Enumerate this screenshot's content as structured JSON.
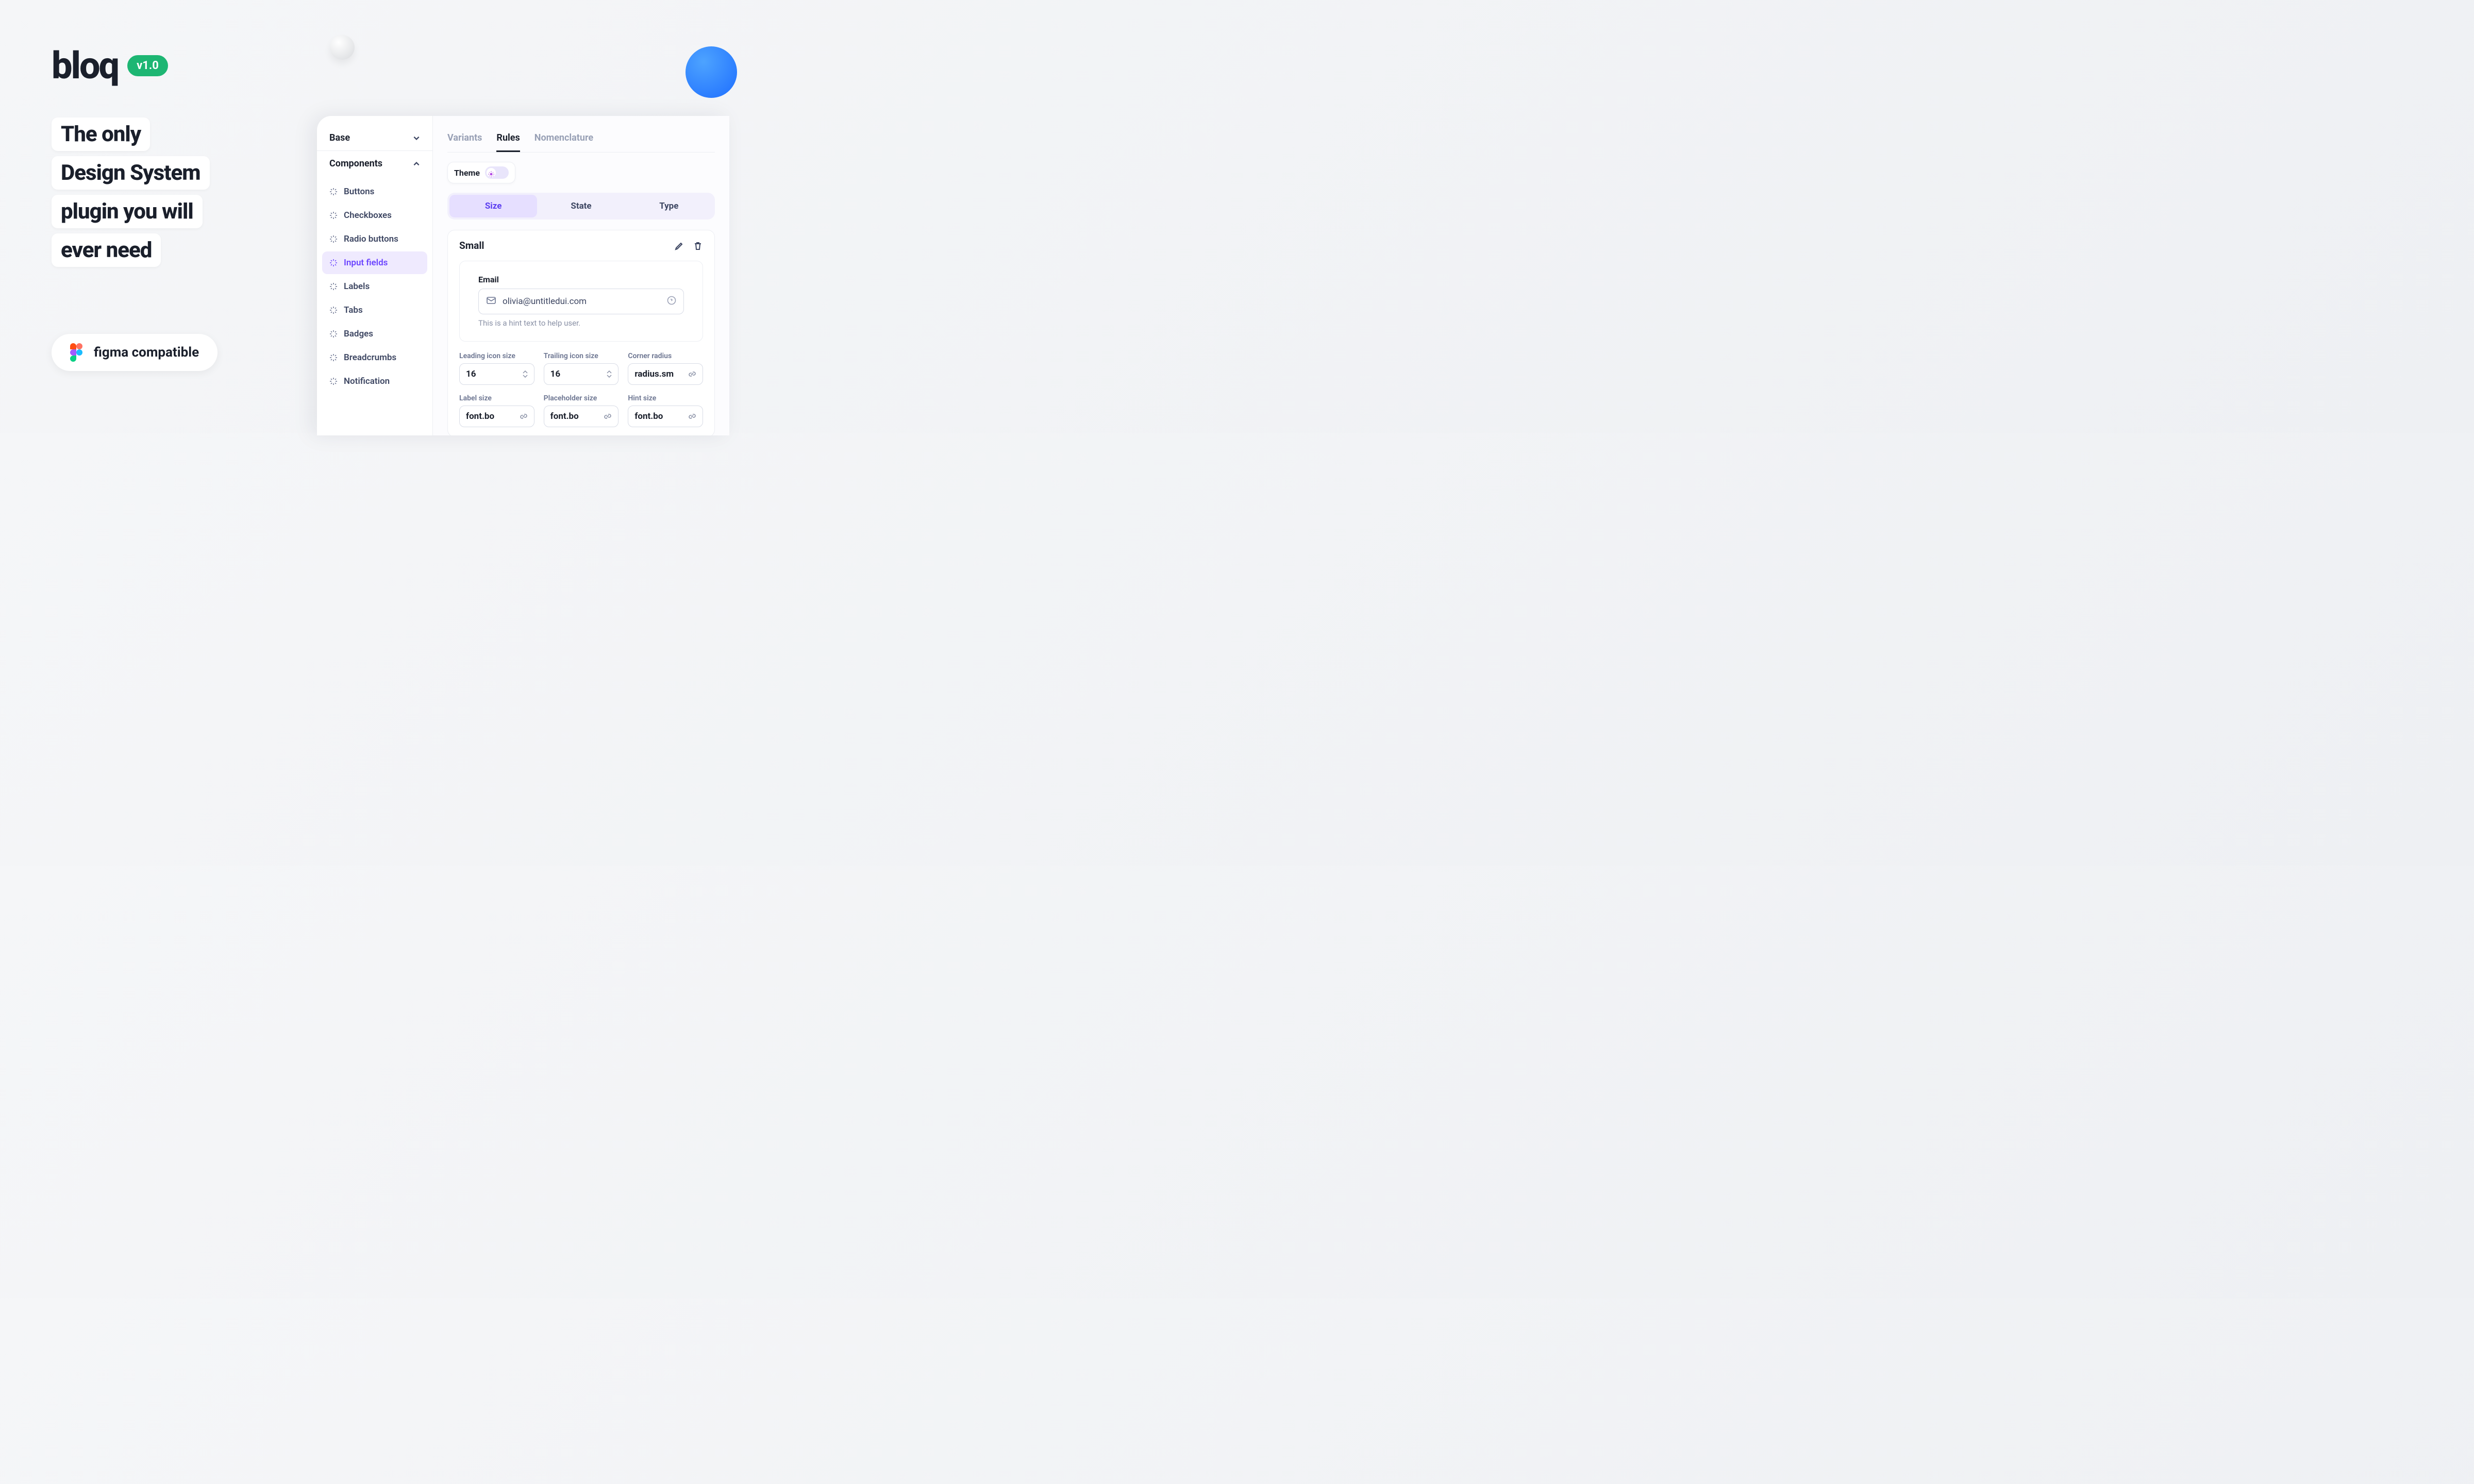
{
  "hero": {
    "logo": "bloq",
    "version": "v1.0",
    "tagline": [
      "The only",
      "Design System",
      "plugin you will",
      "ever need"
    ],
    "figma_label": "figma compatible"
  },
  "sidebar": {
    "base_label": "Base",
    "components_label": "Components",
    "items": [
      {
        "label": "Buttons"
      },
      {
        "label": "Checkboxes"
      },
      {
        "label": "Radio buttons"
      },
      {
        "label": "Input fields"
      },
      {
        "label": "Labels"
      },
      {
        "label": "Tabs"
      },
      {
        "label": "Badges"
      },
      {
        "label": "Breadcrumbs"
      },
      {
        "label": "Notification"
      }
    ],
    "active_index": 3
  },
  "tabs": {
    "items": [
      "Variants",
      "Rules",
      "Nomenclature"
    ],
    "active": "Rules"
  },
  "theme": {
    "label": "Theme",
    "mode": "light"
  },
  "segmented": {
    "items": [
      "Size",
      "State",
      "Type"
    ],
    "active": "Size"
  },
  "card": {
    "title": "Small",
    "preview": {
      "label": "Email",
      "value": "olivia@untitledui.com",
      "hint": "This is a hint text to help user."
    },
    "controls": {
      "row1": [
        {
          "label": "Leading icon size",
          "value": "16",
          "type": "stepper"
        },
        {
          "label": "Trailing icon size",
          "value": "16",
          "type": "stepper"
        },
        {
          "label": "Corner radius",
          "value": "radius.sm",
          "type": "link"
        }
      ],
      "row2": [
        {
          "label": "Label size",
          "value": "font.bo",
          "type": "link"
        },
        {
          "label": "Placeholder size",
          "value": "font.bo",
          "type": "link"
        },
        {
          "label": "Hint size",
          "value": "font.bo",
          "type": "link"
        }
      ]
    }
  }
}
